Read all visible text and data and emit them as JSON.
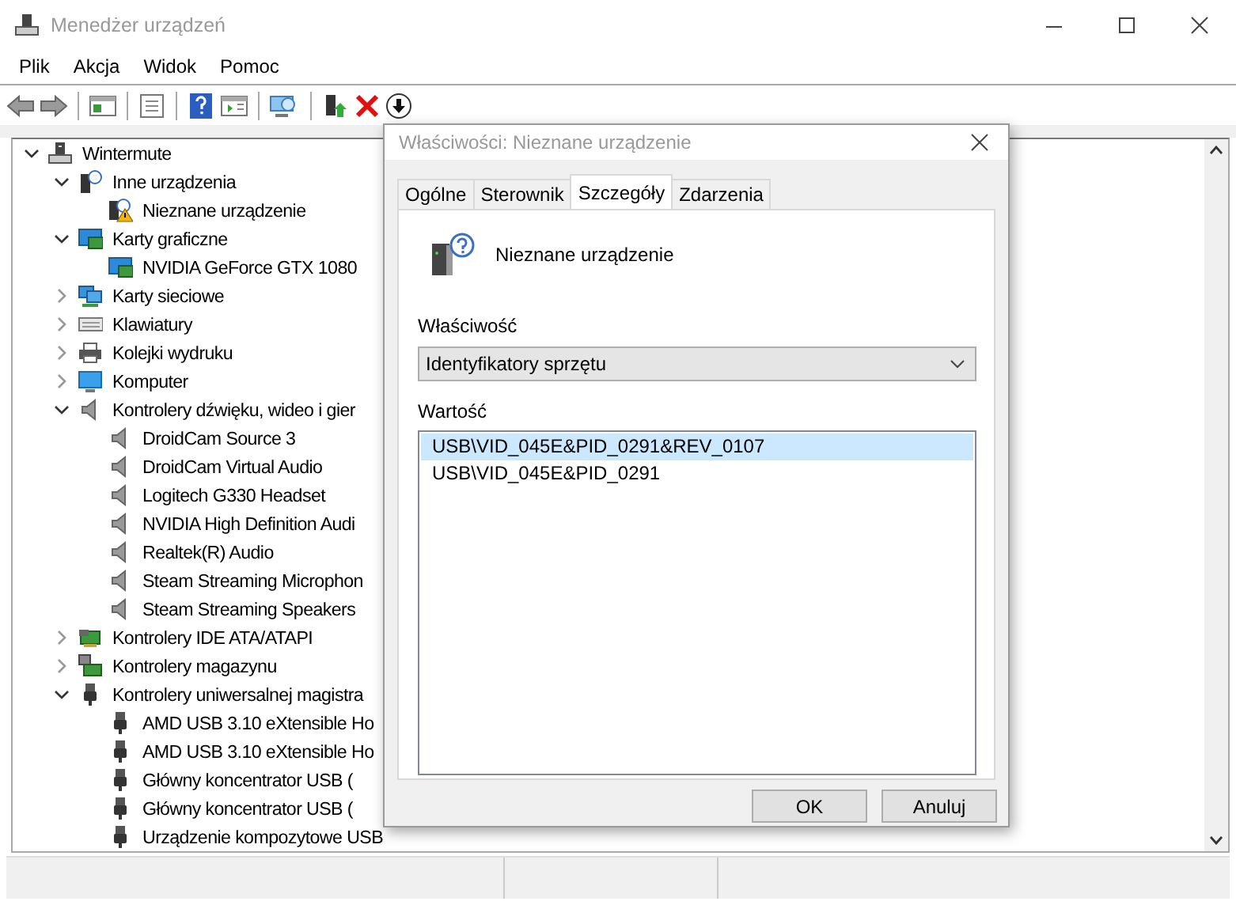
{
  "window": {
    "title": "Menedżer urządzeń"
  },
  "menu": [
    "Plik",
    "Akcja",
    "Widok",
    "Pomoc"
  ],
  "tree": [
    {
      "label": "Wintermute",
      "kind": "computer",
      "expanded": true,
      "children": [
        {
          "label": "Inne urządzenia",
          "kind": "unknown",
          "expanded": true,
          "children": [
            {
              "label": "Nieznane urządzenie",
              "kind": "warning"
            }
          ]
        },
        {
          "label": "Karty graficzne",
          "kind": "display",
          "expanded": true,
          "children": [
            {
              "label": "NVIDIA GeForce GTX 1080",
              "kind": "display"
            }
          ]
        },
        {
          "label": "Karty sieciowe",
          "kind": "network",
          "expanded": false
        },
        {
          "label": "Klawiatury",
          "kind": "keyboard",
          "expanded": false
        },
        {
          "label": "Kolejki wydruku",
          "kind": "printer",
          "expanded": false
        },
        {
          "label": "Komputer",
          "kind": "monitor",
          "expanded": false
        },
        {
          "label": "Kontrolery dźwięku, wideo i gier",
          "kind": "speaker",
          "expanded": true,
          "children": [
            {
              "label": "DroidCam Source 3",
              "kind": "speaker"
            },
            {
              "label": "DroidCam Virtual Audio",
              "kind": "speaker"
            },
            {
              "label": "Logitech G330 Headset",
              "kind": "speaker"
            },
            {
              "label": "NVIDIA High Definition Audi",
              "kind": "speaker"
            },
            {
              "label": "Realtek(R) Audio",
              "kind": "speaker"
            },
            {
              "label": "Steam Streaming Microphon",
              "kind": "speaker"
            },
            {
              "label": "Steam Streaming Speakers",
              "kind": "speaker"
            }
          ]
        },
        {
          "label": "Kontrolery IDE ATA/ATAPI",
          "kind": "ide",
          "expanded": false
        },
        {
          "label": "Kontrolery magazynu",
          "kind": "storage",
          "expanded": false
        },
        {
          "label": "Kontrolery uniwersalnej magistra",
          "kind": "usb",
          "expanded": true,
          "children": [
            {
              "label": "AMD USB 3.10 eXtensible Ho",
              "kind": "usb"
            },
            {
              "label": "AMD USB 3.10 eXtensible Ho",
              "kind": "usb"
            },
            {
              "label": "Główny koncentrator USB (",
              "kind": "usb"
            },
            {
              "label": "Główny koncentrator USB (",
              "kind": "usb"
            },
            {
              "label": "Urządzenie kompozytowe USB",
              "kind": "usb"
            }
          ]
        }
      ]
    }
  ],
  "dialog": {
    "title": "Właściwości: Nieznane urządzenie",
    "tabs": [
      {
        "label": "Ogólne",
        "selected": false
      },
      {
        "label": "Sterownik",
        "selected": false
      },
      {
        "label": "Szczegóły",
        "selected": true
      },
      {
        "label": "Zdarzenia",
        "selected": false
      }
    ],
    "device_name": "Nieznane urządzenie",
    "property_label": "Właściwość",
    "property_value": "Identyfikatory sprzętu",
    "value_label": "Wartość",
    "values": [
      {
        "text": "USB\\VID_045E&PID_0291&REV_0107",
        "selected": true
      },
      {
        "text": "USB\\VID_045E&PID_0291",
        "selected": false
      }
    ],
    "buttons": [
      "OK",
      "Anuluj"
    ]
  }
}
